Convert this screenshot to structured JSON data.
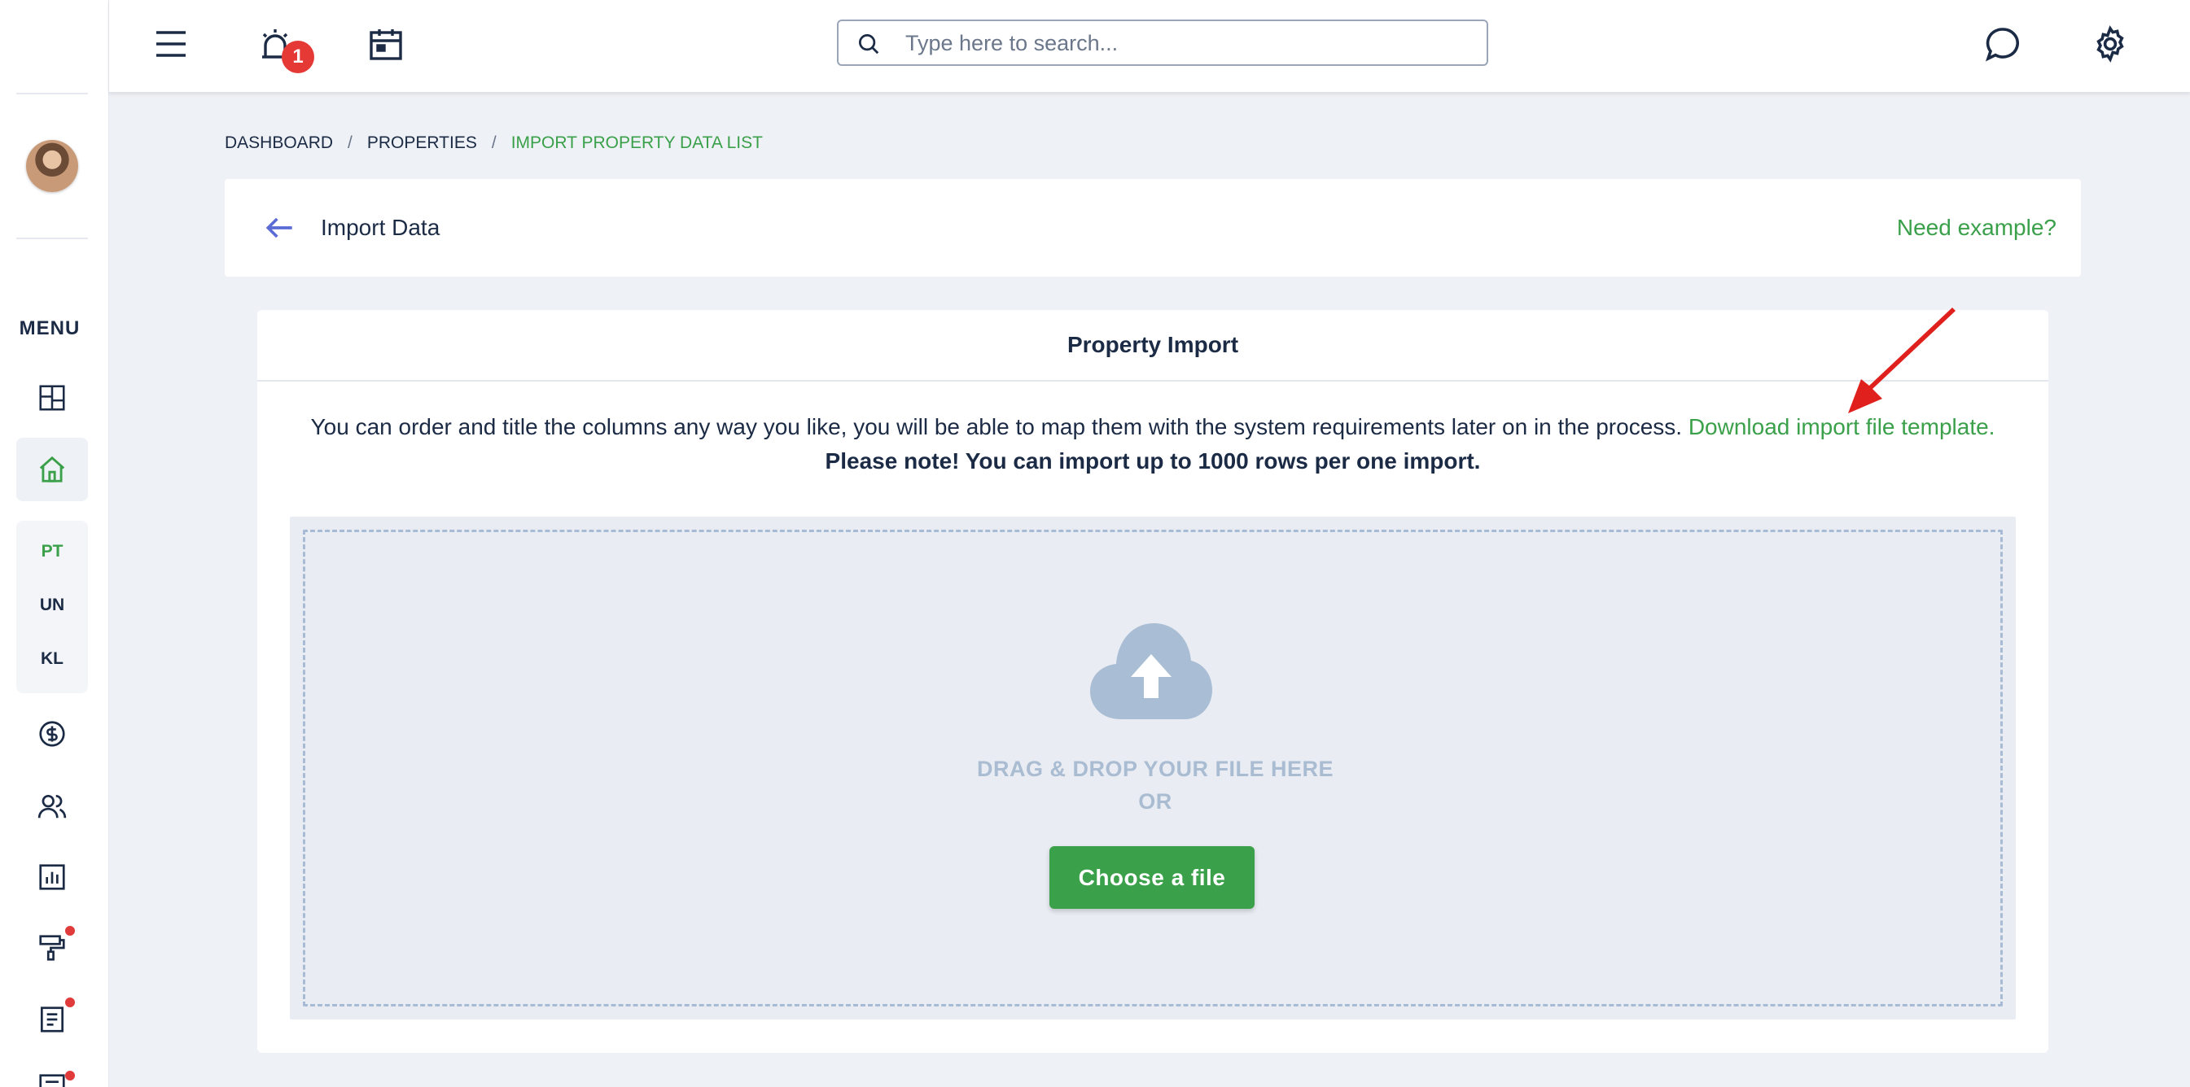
{
  "sidebar": {
    "menu_label": "MENU",
    "sub_items": [
      {
        "label": "PT",
        "color": "#3aa04a"
      },
      {
        "label": "UN",
        "color": "#1c2b45"
      },
      {
        "label": "KL",
        "color": "#1c2b45"
      }
    ],
    "icons": [
      "dashboard-icon",
      "home-icon",
      "dollar-icon",
      "users-icon",
      "chart-icon",
      "paint-roller-icon",
      "document-icon",
      "form-icon"
    ]
  },
  "topbar": {
    "notification_count": "1",
    "search_placeholder": "Type here to search...",
    "icons": [
      "hamburger-menu-icon",
      "alarm-icon",
      "calendar-icon",
      "chat-icon",
      "gear-icon"
    ]
  },
  "breadcrumb": {
    "items": [
      "DASHBOARD",
      "PROPERTIES",
      "IMPORT PROPERTY DATA LIST"
    ],
    "separator": "/"
  },
  "header": {
    "title": "Import Data",
    "need_example": "Need example?"
  },
  "import": {
    "title": "Property Import",
    "description": "You can order and title the columns any way you like, you will be able to map them with the system requirements later on in the process.",
    "template_link": "Download import file template.",
    "note": "Please note! You can import up to 1000 rows per one import.",
    "drag_text": "DRAG & DROP YOUR FILE HERE",
    "or_text": "OR",
    "choose_button": "Choose a file"
  },
  "colors": {
    "accent_green": "#3aa04a",
    "text_dark": "#1c2b45",
    "badge_red": "#e53935",
    "annotation_arrow": "#e0201c"
  }
}
